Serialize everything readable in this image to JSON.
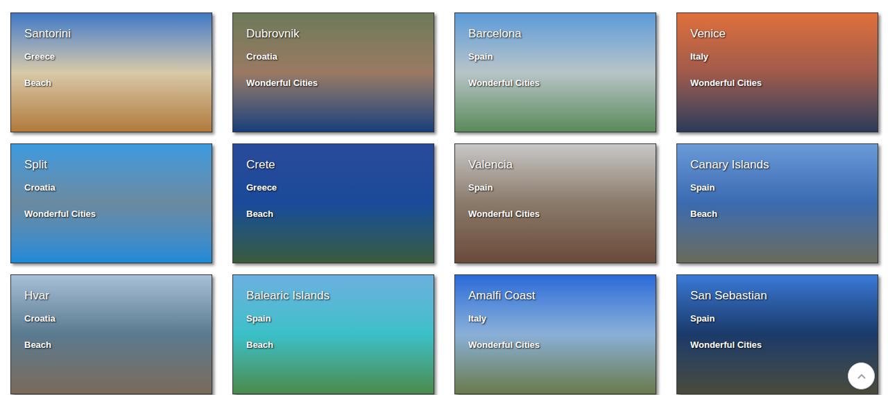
{
  "destinations": [
    {
      "name": "Santorini",
      "country": "Greece",
      "category": "Beach"
    },
    {
      "name": "Dubrovnik",
      "country": "Croatia",
      "category": "Wonderful Cities"
    },
    {
      "name": "Barcelona",
      "country": "Spain",
      "category": "Wonderful Cities"
    },
    {
      "name": "Venice",
      "country": "Italy",
      "category": "Wonderful Cities"
    },
    {
      "name": "Split",
      "country": "Croatia",
      "category": "Wonderful Cities"
    },
    {
      "name": "Crete",
      "country": "Greece",
      "category": "Beach"
    },
    {
      "name": "Valencia",
      "country": "Spain",
      "category": "Wonderful Cities"
    },
    {
      "name": "Canary Islands",
      "country": "Spain",
      "category": "Beach"
    },
    {
      "name": "Hvar",
      "country": "Croatia",
      "category": "Beach"
    },
    {
      "name": "Balearic Islands",
      "country": "Spain",
      "category": "Beach"
    },
    {
      "name": "Amalfi Coast",
      "country": "Italy",
      "category": "Wonderful Cities"
    },
    {
      "name": "San Sebastian",
      "country": "Spain",
      "category": "Wonderful Cities"
    }
  ]
}
